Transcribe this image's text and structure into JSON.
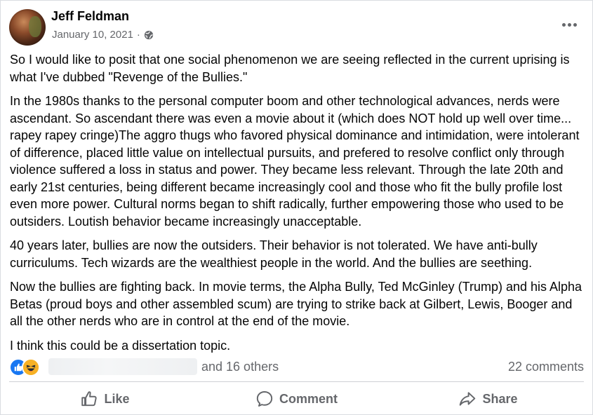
{
  "post": {
    "author": "Jeff Feldman",
    "date": "January 10, 2021",
    "separator": "·",
    "privacy_icon": "globe-icon",
    "paragraphs": [
      "So I would like to posit that one social phenomenon we are seeing reflected in the current uprising is what I've dubbed \"Revenge of the Bullies.\"",
      "In the 1980s thanks to the personal computer boom and other technological advances, nerds were ascendant. So ascendant there was even a movie about it (which does NOT hold up well over time... rapey rapey cringe)The aggro thugs who favored physical dominance and intimidation, were intolerant of difference, placed little value on intellectual pursuits, and prefered to resolve conflict only through violence suffered a loss in status and power. They became less relevant. Through the late 20th and early 21st centuries, being different became increasingly cool and those who fit the bully profile lost even more power. Cultural norms began to shift radically, further empowering those who used to be outsiders. Loutish behavior became increasingly unacceptable.",
      "40 years later, bullies are now the outsiders. Their behavior is not tolerated. We have anti-bully curriculums. Tech wizards are the wealthiest people in the world. And the bullies are seething.",
      "Now the bullies are fighting back. In movie terms, the Alpha Bully, Ted McGinley (Trump) and his Alpha Betas (proud boys and other assembled scum) are trying to strike back at Gilbert, Lewis, Booger and all the other nerds who are in control at the end of the movie.",
      "I think this could be a dissertation topic."
    ]
  },
  "reactions": {
    "icons": [
      "like-reaction-icon",
      "haha-reaction-icon"
    ],
    "others_text": "and 16 others",
    "comments_text": "22 comments"
  },
  "actions": {
    "like": "Like",
    "comment": "Comment",
    "share": "Share"
  },
  "colors": {
    "text": "#050505",
    "secondary": "#65676b",
    "like_blue": "#1877f2",
    "haha_yellow": "#f7b125",
    "divider": "#ced0d4"
  }
}
